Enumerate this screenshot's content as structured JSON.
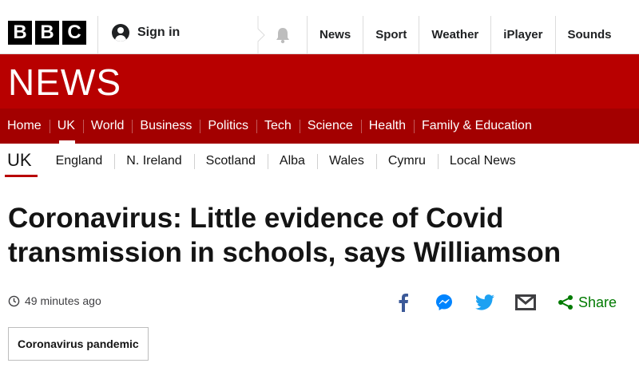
{
  "masthead": {
    "logo_letters": [
      "B",
      "B",
      "C"
    ],
    "sign_in_label": "Sign in",
    "nav": [
      "News",
      "Sport",
      "Weather",
      "iPlayer",
      "Sounds"
    ]
  },
  "news_band": {
    "title": "NEWS",
    "color": "#b80000"
  },
  "section_nav": {
    "items": [
      "Home",
      "UK",
      "World",
      "Business",
      "Politics",
      "Tech",
      "Science",
      "Health",
      "Family & Education"
    ],
    "active": "UK"
  },
  "sub_nav": {
    "current": "UK",
    "items": [
      "England",
      "N. Ireland",
      "Scotland",
      "Alba",
      "Wales",
      "Cymru",
      "Local News"
    ]
  },
  "article": {
    "headline": "Coronavirus: Little evidence of Covid transmission in schools, says Williamson",
    "timestamp": "49 minutes ago",
    "share_label": "Share",
    "share_icons": [
      "facebook-icon",
      "messenger-icon",
      "twitter-icon",
      "email-icon"
    ],
    "topic_tag": "Coronavirus pandemic"
  },
  "colors": {
    "brand_red": "#b80000",
    "nav_red": "#a30000",
    "share_green": "#007a00",
    "facebook": "#3b5998",
    "messenger": "#0084ff",
    "twitter": "#1da1f2",
    "email": "#3f3f42"
  }
}
